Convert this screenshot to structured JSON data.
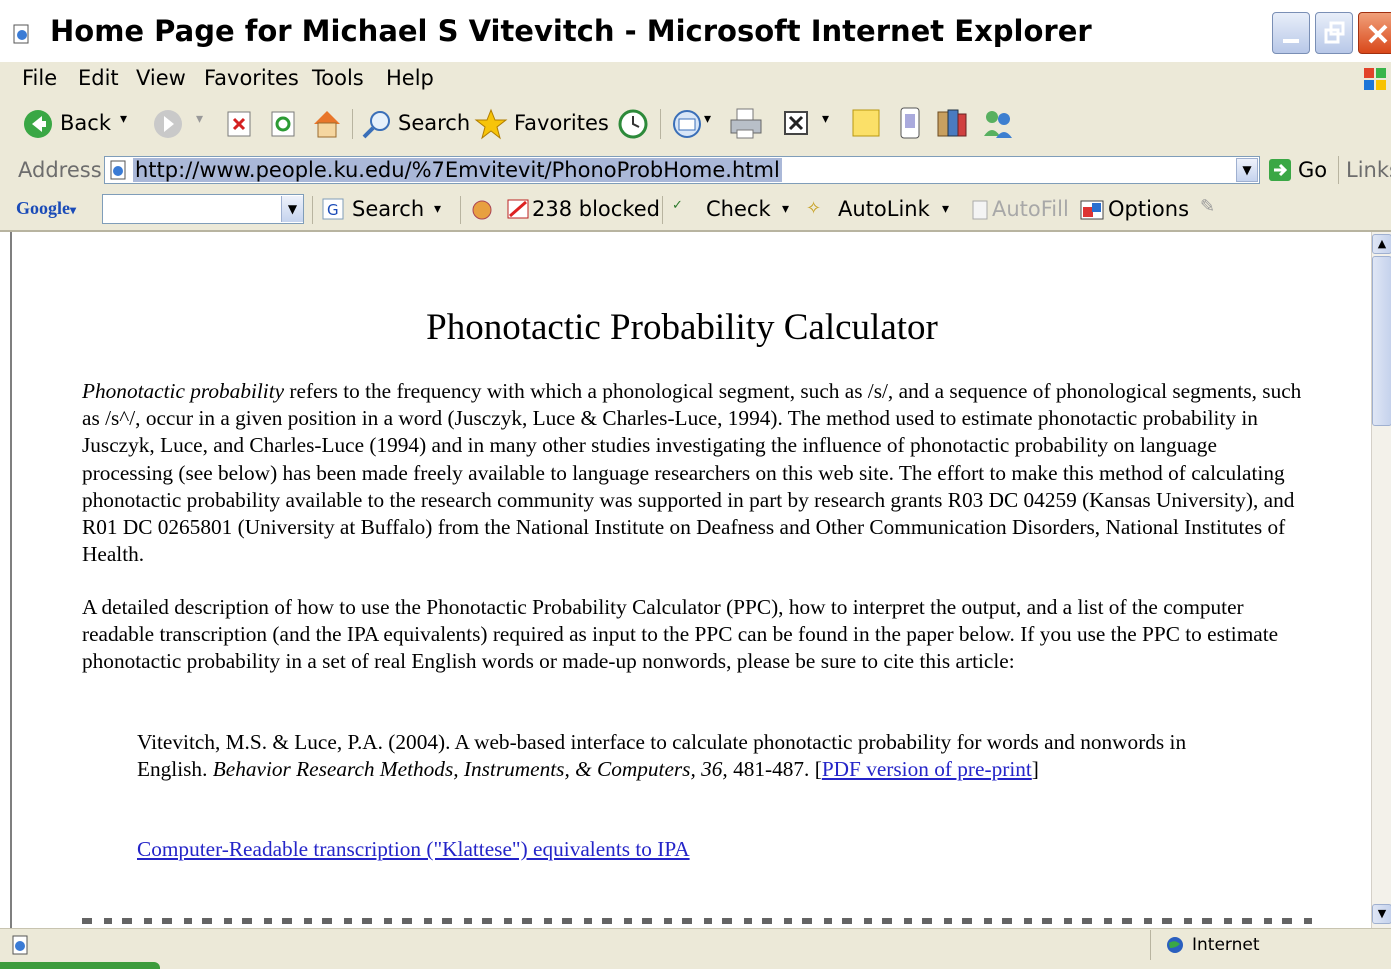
{
  "window": {
    "title": "Home Page for Michael S Vitevitch - Microsoft Internet Explorer"
  },
  "menu": [
    "File",
    "Edit",
    "View",
    "Favorites",
    "Tools",
    "Help"
  ],
  "toolbar": {
    "back_label": "Back",
    "search_label": "Search",
    "favorites_label": "Favorites"
  },
  "address": {
    "label": "Address",
    "url": "http://www.people.ku.edu/%7Emvitevit/PhonoProbHome.html",
    "go_label": "Go",
    "links_label": "Links"
  },
  "google_bar": {
    "logo": "Google",
    "search_label": "Search",
    "blocked_label": "238 blocked",
    "check_label": "Check",
    "autolink_label": "AutoLink",
    "autofill_label": "AutoFill",
    "options_label": "Options"
  },
  "page": {
    "title": "Phonotactic Probability Calculator",
    "intro_italic": "Phonotactic probability",
    "intro_rest": " refers to the frequency with which a phonological segment, such as /s/, and a sequence of phonological segments, such as /s^/, occur in a given position in a word (Jusczyk, Luce & Charles-Luce, 1994). The method used to estimate phonotactic probability in Jusczyk, Luce, and Charles-Luce (1994) and in many other studies investigating the influence of phonotactic probability on language processing (see below) has been made freely available to language researchers on this web site. The effort to make this method of calculating phonotactic probability available to the research community was supported in part by research grants R03 DC 04259 (Kansas University), and R01 DC 0265801 (University at Buffalo) from the National Institute on Deafness and Other Communication Disorders, National Institutes of Health.",
    "para2": "A detailed description of how to use the Phonotactic Probability Calculator (PPC), how to interpret the output, and a list of the computer readable transcription (and the IPA equivalents) required as input to the PPC can be found in the paper below. If you use the PPC to estimate phonotactic probability in a set of real English words or made-up nonwords, please be sure to cite this article:",
    "cite_authors": "Vitevitch, M.S. & Luce, P.A. (2004). A web-based interface to calculate phonotactic probability for words and nonwords in English.  ",
    "cite_journal": "Behavior Research Methods, Instruments, & Computers, 36,",
    "cite_pages": " 481-487. [",
    "cite_link": "PDF version of pre-print",
    "cite_close": "]",
    "klattese_link": "Computer-Readable transcription (\"Klattese\") equivalents to IPA"
  },
  "status": {
    "zone": "Internet"
  }
}
